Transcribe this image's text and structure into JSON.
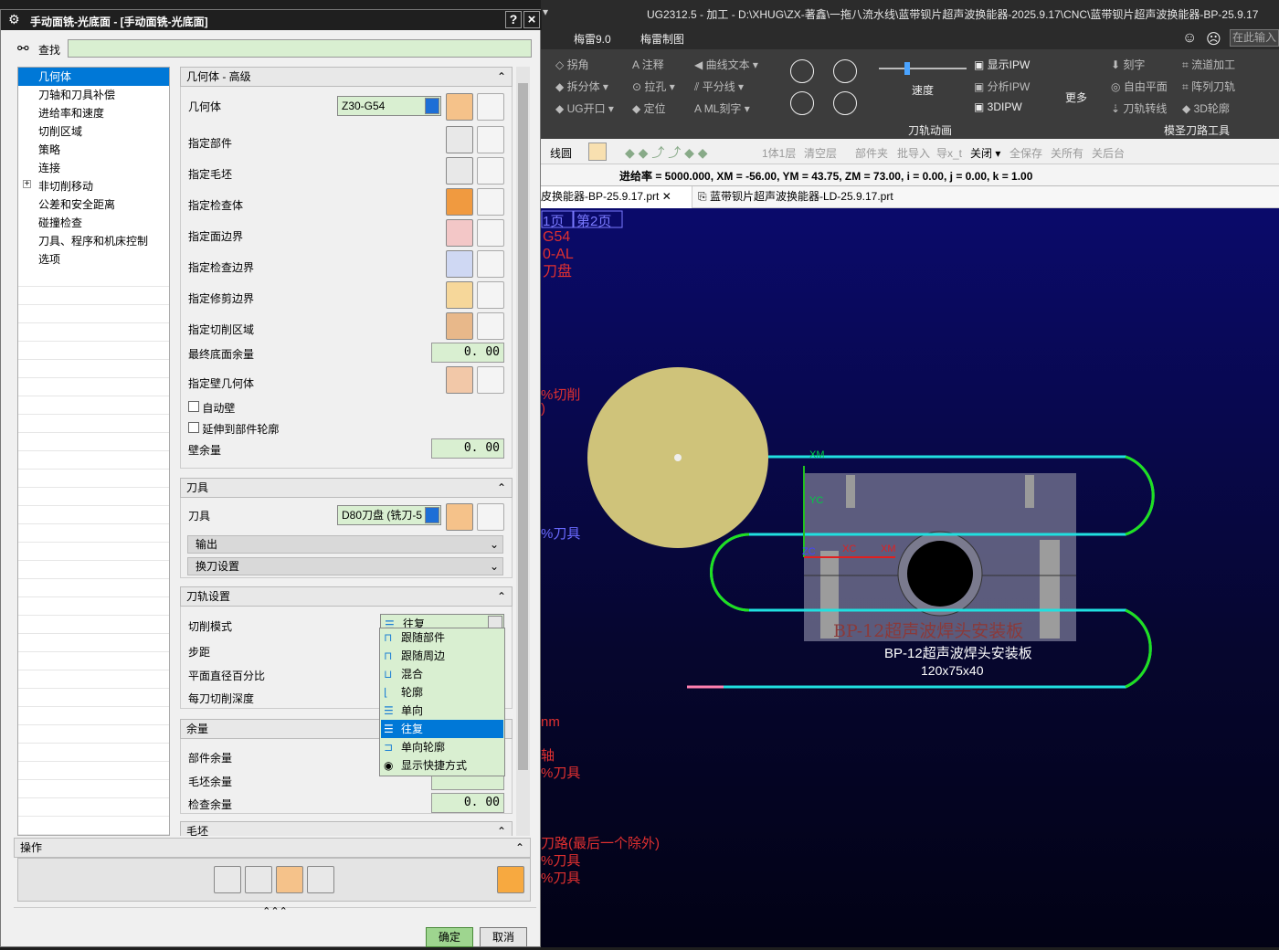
{
  "app": {
    "title_text": "UG2312.5 - 加工 - D:\\XHUG\\ZX-著鑫\\一拖八流水线\\蓝带钡片超声波换能器-2025.9.17\\CNC\\蓝带钡片超声波换能器-BP-25.9.17",
    "search_placeholder": "在此输入",
    "ribbon_tabs": [
      "梅雷9.0",
      "梅雷制图"
    ],
    "ribbon_col1": [
      "拐角",
      "拆分体",
      "UG开口"
    ],
    "ribbon_col2": [
      "注释",
      "拉孔",
      "定位"
    ],
    "ribbon_col3": [
      "曲线文本",
      "平分线",
      "ML刻字"
    ],
    "ribbon_display": [
      "显示IPW",
      "分析IPW",
      "3DIPW"
    ],
    "ribbon_speed": "速度",
    "ribbon_more": "更多",
    "ribbon_group1": "刀轨动画",
    "ribbon_right_col1": [
      "刻字",
      "自由平面",
      "刀轨转线"
    ],
    "ribbon_right_col2": [
      "流道加工",
      "阵列刀轨",
      "3D轮廓"
    ],
    "ribbon_group2": "模圣刀路工具",
    "cmd_items": [
      "线圆",
      "1体1层",
      "清空层",
      "部件夹",
      "批导入",
      "导x_t",
      "关闭",
      "全保存",
      "关所有",
      "关后台"
    ],
    "status_text": "进给率 = 5000.000, XM = -56.00, YM = 43.75, ZM = 73.00, i = 0.00, j = 0.00, k = 1.00",
    "file_tab1": "皮换能器-BP-25.9.17.prt",
    "file_tab2": "蓝带钡片超声波换能器-LD-25.9.17.prt"
  },
  "viewport": {
    "page_tabs": [
      "1页",
      "第2页"
    ],
    "notes_top": [
      "G54",
      "0-AL",
      "刀盘"
    ],
    "note_cut": "%切削",
    "note_zero": ")",
    "note_tool": "%刀具",
    "axis_xm": "XM",
    "axis_yc": "YC",
    "axis_zc": "ZC",
    "axis_xc": "XC",
    "axis_xm2": "XM",
    "part_stamp": "BP-12超声波焊头安装板",
    "part_label1": "BP-12超声波焊头安装板",
    "part_label2": "120x75x40",
    "notes_bottom": [
      "nm",
      "轴",
      "%刀具"
    ],
    "notes_end": [
      "刀路(最后一个除外)",
      "%刀具",
      "%刀具"
    ]
  },
  "dialog": {
    "title": "手动面铣-光底面 - [手动面铣-光底面]",
    "help": "?",
    "close": "×",
    "find_label": "查找",
    "tree": [
      "几何体",
      "刀轴和刀具补偿",
      "进给率和速度",
      "切削区域",
      "策略",
      "连接",
      "非切削移动",
      "公差和安全距离",
      "碰撞检查",
      "刀具、程序和机床控制",
      "选项"
    ],
    "geometry_section": "几何体 - 高级",
    "geometry_label": "几何体",
    "geometry_value": "Z30-G54",
    "geom_rows": [
      "指定部件",
      "指定毛坯",
      "指定检查体",
      "指定面边界",
      "指定检查边界",
      "指定修剪边界",
      "指定切削区域"
    ],
    "final_floor_label": "最终底面余量",
    "final_floor_value": "0. 00",
    "wall_geom_label": "指定壁几何体",
    "auto_wall": "自动壁",
    "extend_outline": "延伸到部件轮廓",
    "wall_stock_label": "壁余量",
    "wall_stock_value": "0. 00",
    "tool_section": "刀具",
    "tool_label": "刀具",
    "tool_value": "D80刀盘 (铣刀-5",
    "output_label": "输出",
    "tool_change_label": "换刀设置",
    "path_section": "刀轨设置",
    "cut_mode_label": "切削模式",
    "cut_mode_value": "往复",
    "stepover_label": "步距",
    "flat_pct_label": "平面直径百分比",
    "depth_label": "每刀切削深度",
    "cut_mode_options": [
      "跟随部件",
      "跟随周边",
      "混合",
      "轮廓",
      "单向",
      "往复",
      "单向轮廓",
      "显示快捷方式"
    ],
    "stock_section": "余量",
    "part_stock_label": "部件余量",
    "blank_stock_label": "毛坯余量",
    "check_stock_label": "检查余量",
    "check_stock_value": "0. 00",
    "blank_section": "毛坯",
    "ops_section": "操作",
    "ok": "确定",
    "cancel": "取消"
  }
}
